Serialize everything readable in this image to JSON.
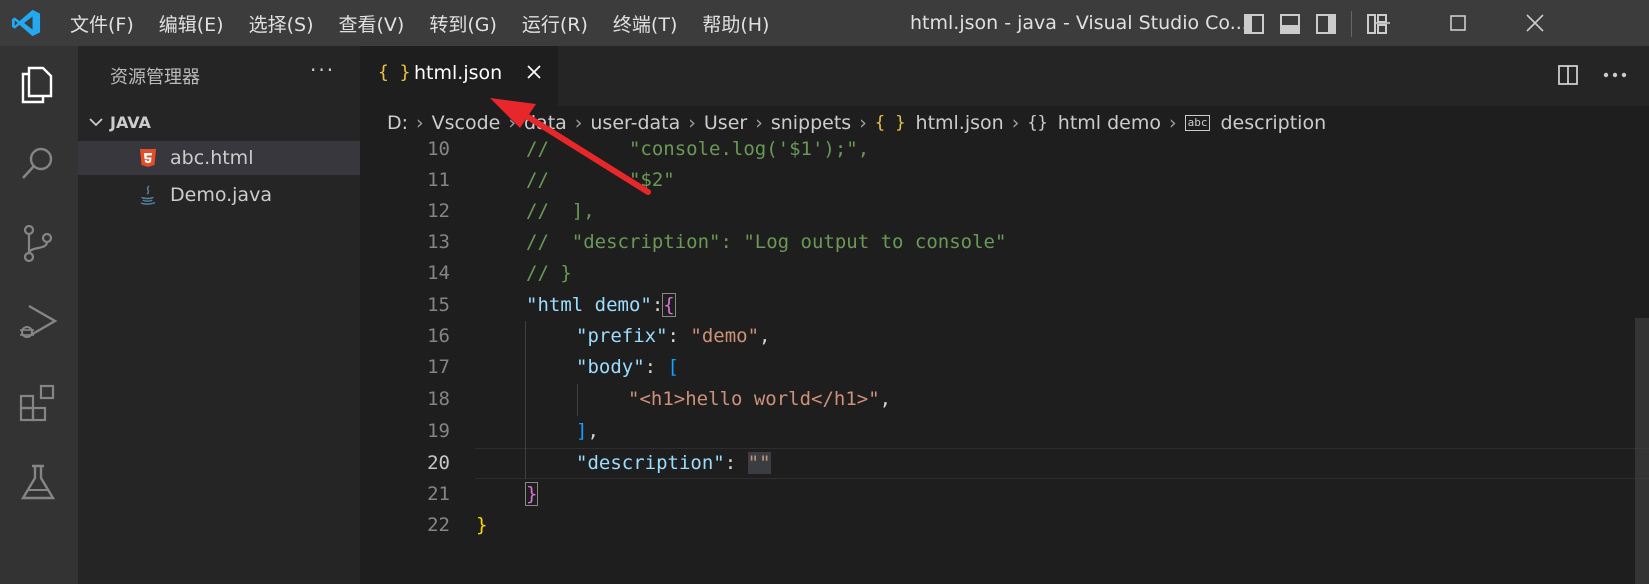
{
  "menu": [
    "文件(F)",
    "编辑(E)",
    "选择(S)",
    "查看(V)",
    "转到(G)",
    "运行(R)",
    "终端(T)",
    "帮助(H)"
  ],
  "window_title": "html.json - java - Visual Studio Co...",
  "sidebar": {
    "title": "资源管理器",
    "more": "···",
    "section": "JAVA",
    "files": [
      {
        "name": "abc.html",
        "icon": "html5-icon",
        "active": true
      },
      {
        "name": "Demo.java",
        "icon": "java-icon",
        "active": false
      }
    ]
  },
  "tab": {
    "icon": "{ }",
    "name": "html.json"
  },
  "breadcrumb": [
    "D:",
    "Vscode",
    "data",
    "user-data",
    "User",
    "snippets",
    "html.json",
    "html demo",
    "description"
  ],
  "breadcrumb_icons": {
    "json": "{ }",
    "object": "{}",
    "string": "abc"
  },
  "line_numbers": [
    "10",
    "11",
    "12",
    "13",
    "14",
    "15",
    "16",
    "17",
    "18",
    "19",
    "20",
    "21",
    "22"
  ],
  "current_line": "20",
  "code": {
    "l10": "//       \"console.log('$1');\",",
    "l11": "//       \"$2\"",
    "l12": "//  ],",
    "l13": "//  \"description\": \"Log output to console\"",
    "l14": "// }",
    "l15_key": "\"html demo\"",
    "l15_colon": ":",
    "l15_brace": "{",
    "l16_key": "\"prefix\"",
    "l16_colon": ": ",
    "l16_val": "\"demo\"",
    "l16_comma": ",",
    "l17_key": "\"body\"",
    "l17_colon": ": ",
    "l17_brace": "[",
    "l18_val": "\"<h1>hello world</h1>\"",
    "l18_comma": ",",
    "l19_brace": "]",
    "l19_comma": ",",
    "l20_key": "\"description\"",
    "l20_colon": ": ",
    "l20_q1": "\"",
    "l20_q2": "\"",
    "l21_brace": "}",
    "l22_brace": "}"
  },
  "colors": {
    "arrow": "#e8272b",
    "accent": "#007acc"
  }
}
